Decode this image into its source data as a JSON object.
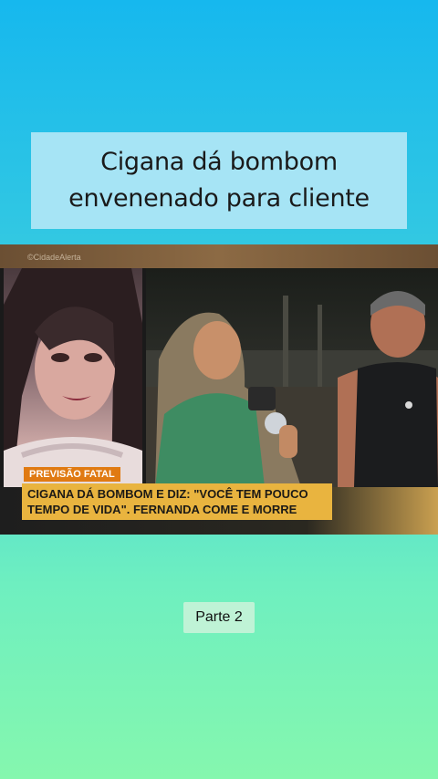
{
  "title": {
    "line1": "Cigana dá bombom",
    "line2": "envenenado para cliente"
  },
  "video": {
    "watermark": "©CidadeAlerta",
    "tag": "PREVISÃO FATAL",
    "headline_line1": "CIGANA DÁ BOMBOM E DIZ: \"VOCÊ TEM POUCO",
    "headline_line2": "TEMPO DE VIDA\". FERNANDA COME E MORRE"
  },
  "part_label": "Parte 2"
}
